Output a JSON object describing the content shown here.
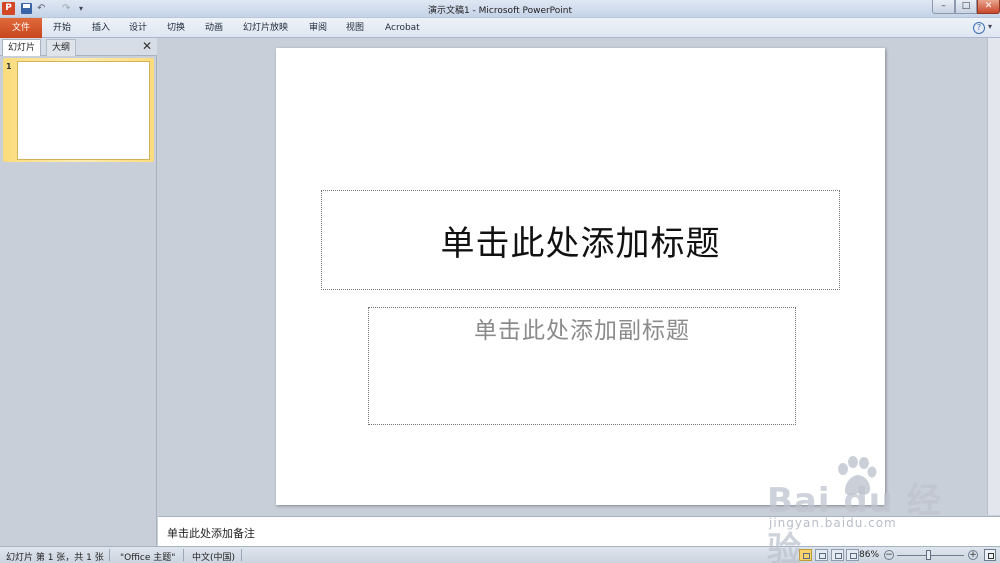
{
  "window": {
    "title": "演示文稿1 - Microsoft PowerPoint",
    "app_icon": "P",
    "controls": {
      "minimize": "–",
      "maximize": "□",
      "close": "✕"
    }
  },
  "ribbon": {
    "file_tab": "文件",
    "tabs": [
      "开始",
      "插入",
      "设计",
      "切换",
      "动画",
      "幻灯片放映",
      "审阅",
      "视图",
      "Acrobat"
    ],
    "help_label": "?",
    "expand_label": "▾"
  },
  "left_pane": {
    "tabs": [
      "幻灯片",
      "大纲"
    ],
    "close_label": "✕",
    "slide_number": "1"
  },
  "slide": {
    "title_placeholder": "单击此处添加标题",
    "subtitle_placeholder": "单击此处添加副标题"
  },
  "notes": {
    "placeholder": "单击此处添加备注"
  },
  "status_bar": {
    "slide_info": "幻灯片 第 1 张，共 1 张",
    "theme": "\"Office 主题\"",
    "language": "中文(中国)",
    "zoom": "86%",
    "zoom_out": "−",
    "zoom_in": "+"
  },
  "watermark": {
    "brand": "Bai du 经验",
    "url": "jingyan.baidu.com"
  },
  "colors": {
    "file_tab": "#c8461d",
    "selected_thumb": "#fbdc7c",
    "workspace": "#c9cfd8"
  },
  "icons": [
    "powerpoint-app-icon",
    "save-icon",
    "undo-icon",
    "redo-icon",
    "help-icon",
    "close-icon",
    "normal-view-icon",
    "slide-sorter-icon",
    "reading-view-icon",
    "slideshow-icon",
    "fit-slide-icon"
  ]
}
